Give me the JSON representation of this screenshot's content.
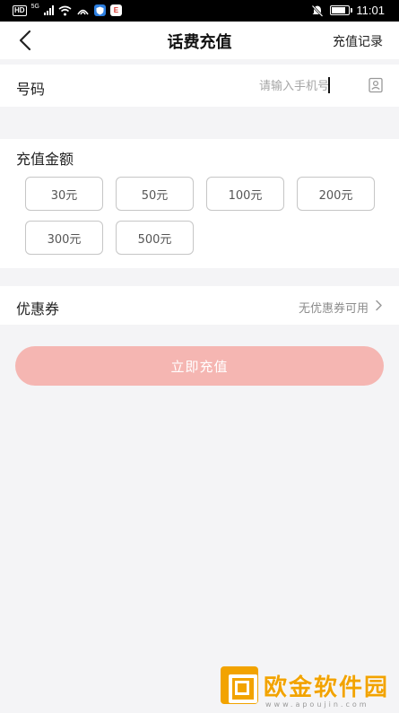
{
  "status_bar": {
    "network_badge": "HD",
    "network_type": "5G",
    "app_badge": "E",
    "time": "11:01",
    "battery_level": 0.9
  },
  "nav": {
    "title": "话费充值",
    "right_action": "充值记录"
  },
  "phone": {
    "label": "号码",
    "value": "",
    "placeholder": "请输入手机号"
  },
  "amount": {
    "label": "充值金额",
    "options": [
      "30元",
      "50元",
      "100元",
      "200元",
      "300元",
      "500元"
    ]
  },
  "coupon": {
    "label": "优惠券",
    "status": "无优惠券可用"
  },
  "submit": {
    "label": "立即充值"
  },
  "watermark": {
    "brand": "欧金软件园",
    "url": "www.apoujin.com"
  },
  "colors": {
    "submit_bg": "#f5b6b2",
    "watermark": "#f2a300"
  }
}
